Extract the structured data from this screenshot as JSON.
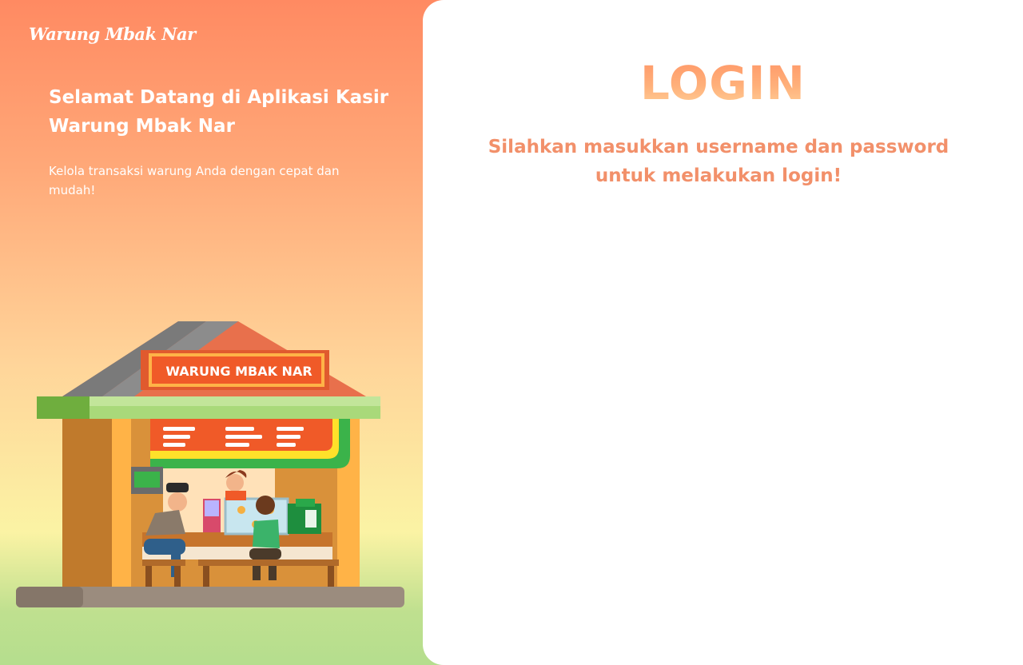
{
  "brand": {
    "name": "Warung Mbak Nar"
  },
  "welcome": {
    "title": "Selamat Datang di Aplikasi Kasir Warung Mbak Nar",
    "subtitle": "Kelola transaksi warung Anda dengan cepat dan mudah!"
  },
  "illustration": {
    "sign_text": "WARUNG MBAK NAR"
  },
  "login": {
    "title": "LOGIN",
    "description": "Silahkan masukkan username dan password untuk melakukan login!"
  },
  "colors": {
    "accent": "#f2906a",
    "gradient_top": "#ff8a62",
    "gradient_bottom": "#b5de8e",
    "panel": "#ffffff"
  }
}
